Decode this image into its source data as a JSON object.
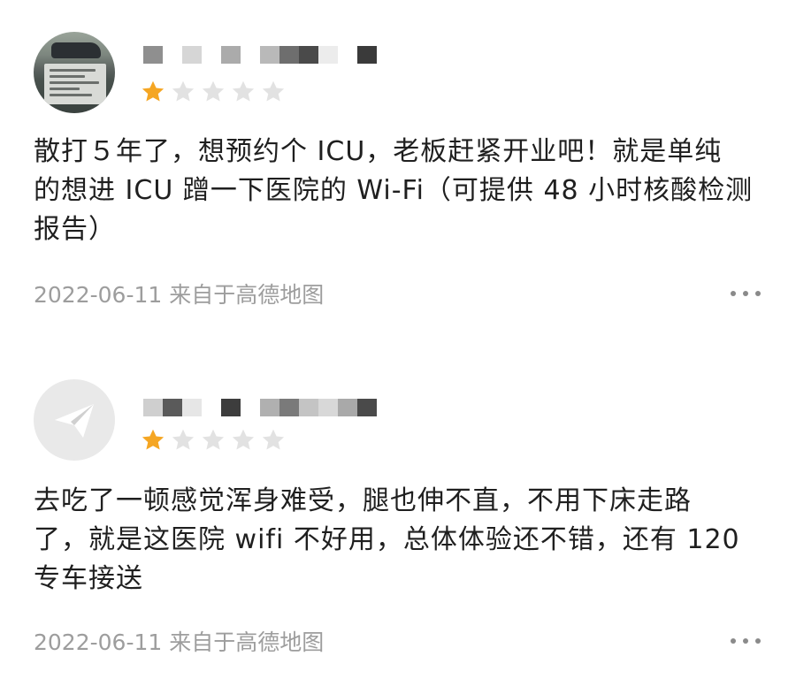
{
  "reviews": [
    {
      "avatar": "photo-avatar",
      "rating": 1,
      "max_rating": 5,
      "text_lines": [
        "散打５年了，想预约个 ICU，老板赶紧开业吧！就是单纯",
        "的想进 ICU 蹭一下医院的 Wi-Fi（可提供 48 小时核酸检测",
        "报告）"
      ],
      "date": "2022-06-11",
      "source": "来自于高德地图"
    },
    {
      "avatar": "paper-plane-icon",
      "rating": 1,
      "max_rating": 5,
      "text_lines": [
        "去吃了一顿感觉浑身难受，腿也伸不直，不用下床走路",
        "了，就是这医院 wifi 不好用，总体体验还不错，还有 120",
        "专车接送"
      ],
      "date": "2022-06-11",
      "source": "来自于高德地图"
    }
  ],
  "colors": {
    "star_filled": "#f5a623",
    "star_empty": "#e2e2e2",
    "meta_text": "#9d9d9d",
    "body_text": "#1f1f1f"
  }
}
